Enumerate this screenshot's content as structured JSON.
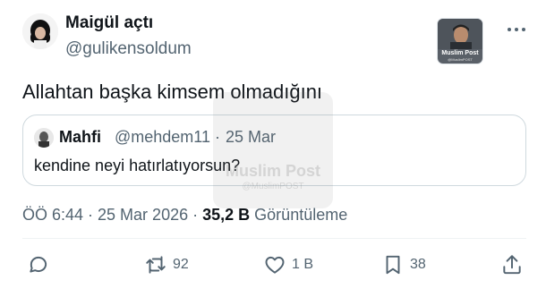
{
  "tweet": {
    "author_name": "Maigül açtı",
    "author_handle": "@gulikensoldum",
    "text": "Allahtan başka kimsem olmadığını",
    "timestamp": "ÖÖ 6:44 · 25 Mar 2026 ·",
    "views_count": "35,2 B",
    "views_label": "Görüntüleme"
  },
  "brand_badge": {
    "line1": "Muslim Post",
    "line2": "@MuslimPOST"
  },
  "quote": {
    "author_name": "Mahfi",
    "author_handle": "@mehdem11",
    "separator": "·",
    "date": "25 Mar",
    "text": "kendine neyi hatırlatıyorsun?"
  },
  "actions": {
    "reply_count": "",
    "retweet_count": "92",
    "like_count": "1 B",
    "bookmark_count": "38"
  },
  "watermark": {
    "line1": "Muslim Post",
    "line2": "@MuslimPOST"
  },
  "icons": {
    "more": "more-horizontal-icon",
    "reply": "reply-icon",
    "retweet": "retweet-icon",
    "like": "heart-icon",
    "bookmark": "bookmark-icon",
    "share": "share-icon"
  },
  "colors": {
    "text_primary": "#0f1419",
    "text_secondary": "#536471",
    "border": "#cfd9de"
  }
}
